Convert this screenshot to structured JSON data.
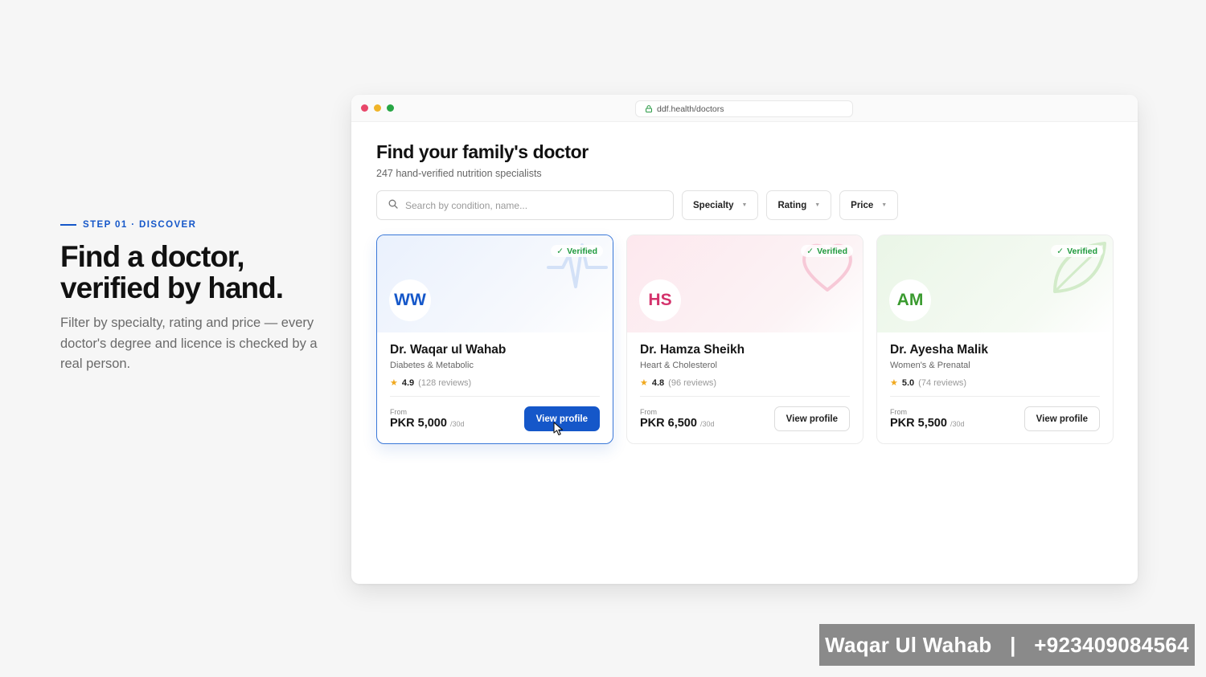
{
  "intro": {
    "step": "STEP 01 · DISCOVER",
    "headline_line1": "Find a doctor,",
    "headline_line2": "verified by hand.",
    "description": "Filter by specialty, rating and price — every doctor's degree and licence is checked by a real person."
  },
  "browser": {
    "url": "ddf.health/doctors"
  },
  "page": {
    "title": "Find your family's doctor",
    "subtitle": "247 hand-verified nutrition specialists"
  },
  "search": {
    "placeholder": "Search by condition, name..."
  },
  "filters": [
    {
      "label": "Specialty"
    },
    {
      "label": "Rating"
    },
    {
      "label": "Price"
    }
  ],
  "cards": [
    {
      "initials": "WW",
      "badge": "Verified",
      "name": "Dr. Waqar ul Wahab",
      "specialty": "Diabetes & Metabolic",
      "rating": "4.9",
      "reviews": "(128 reviews)",
      "from_label": "From",
      "price": "PKR 5,000",
      "period": "/30d",
      "button": "View profile"
    },
    {
      "initials": "HS",
      "badge": "Verified",
      "name": "Dr. Hamza Sheikh",
      "specialty": "Heart & Cholesterol",
      "rating": "4.8",
      "reviews": "(96 reviews)",
      "from_label": "From",
      "price": "PKR 6,500",
      "period": "/30d",
      "button": "View profile"
    },
    {
      "initials": "AM",
      "badge": "Verified",
      "name": "Dr. Ayesha Malik",
      "specialty": "Women's & Prenatal",
      "rating": "5.0",
      "reviews": "(74 reviews)",
      "from_label": "From",
      "price": "PKR 5,500",
      "period": "/30d",
      "button": "View profile"
    }
  ],
  "watermark": {
    "text": "Waqar Ul Wahab   |   +923409084564"
  },
  "colors": {
    "accent": "#1557c9",
    "verified": "#1f9a3d",
    "hs_accent": "#d4336c",
    "am_accent": "#3a9a2f",
    "star": "#f0a81d"
  }
}
